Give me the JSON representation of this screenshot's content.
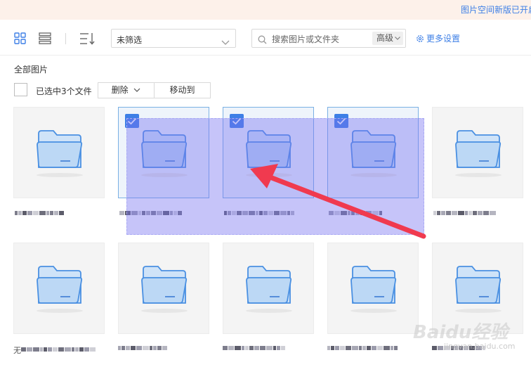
{
  "banner": {
    "text": "图片空间新版已开启"
  },
  "toolbar": {
    "grid_view_icon": "grid-icon",
    "list_view_icon": "list-icon",
    "sort_icon": "sort-icon",
    "filter": {
      "value": "未筛选"
    },
    "search": {
      "placeholder": "搜索图片或文件夹",
      "advanced_label": "高级"
    },
    "more_settings_label": "更多设置"
  },
  "breadcrumb": "全部图片",
  "selection": {
    "count_text": "已选中3个文件",
    "delete_label": "删除",
    "move_label": "移动到"
  },
  "files": [
    {
      "selected": false,
      "name": ""
    },
    {
      "selected": true,
      "name": ""
    },
    {
      "selected": true,
      "name": ""
    },
    {
      "selected": true,
      "name": ""
    },
    {
      "selected": false,
      "name": ""
    },
    {
      "selected": false,
      "name": "无"
    },
    {
      "selected": false,
      "name": ""
    },
    {
      "selected": false,
      "name": ""
    },
    {
      "selected": false,
      "name": ""
    },
    {
      "selected": false,
      "name": ""
    }
  ],
  "watermark": {
    "text": "Baidu经验",
    "sub": "jingyan.baidu.com"
  },
  "colors": {
    "accent": "#3d7fe6",
    "annotation_arrow": "#f03a4f",
    "marquee": "#7873f0"
  }
}
